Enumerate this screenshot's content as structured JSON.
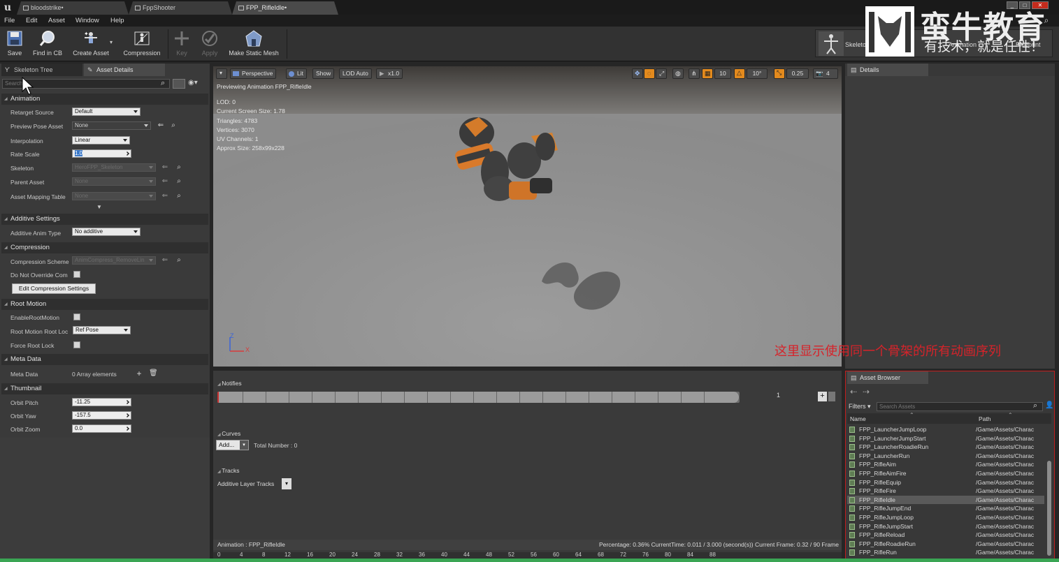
{
  "titlebar": {
    "tabs": [
      {
        "label": "bloodstrike•"
      },
      {
        "label": "FppShooter"
      },
      {
        "label": "FPP_RifleIdle•"
      }
    ],
    "window_buttons": [
      "_",
      "□",
      "✕"
    ]
  },
  "menubar": {
    "items": [
      "File",
      "Edit",
      "Asset",
      "Window",
      "Help"
    ]
  },
  "toolbar": {
    "save": "Save",
    "find_in_cb": "Find in CB",
    "create_asset": "Create Asset",
    "compression": "Compression",
    "key": "Key",
    "apply": "Apply",
    "make_static_mesh": "Make Static Mesh",
    "mode_skeleton": "Skeleton",
    "mode_animation": "Animation",
    "mode_blueprint": "Blueprint"
  },
  "left_panel": {
    "tabs": [
      "Skeleton Tree",
      "Asset Details"
    ],
    "search_placeholder": "Search",
    "animation": {
      "header": "Animation",
      "retarget_source_label": "Retarget Source",
      "retarget_source_value": "Default",
      "preview_pose_label": "Preview Pose Asset",
      "preview_pose_value": "None",
      "interpolation_label": "Interpolation",
      "interpolation_value": "Linear",
      "rate_scale_label": "Rate Scale",
      "rate_scale_value": "1.0",
      "skeleton_label": "Skeleton",
      "skeleton_value": "HeroFPP_Skeleton",
      "parent_asset_label": "Parent Asset",
      "parent_asset_value": "None",
      "asset_mapping_label": "Asset Mapping Table",
      "asset_mapping_value": "None"
    },
    "additive": {
      "header": "Additive Settings",
      "anim_type_label": "Additive Anim Type",
      "anim_type_value": "No additive"
    },
    "compression": {
      "header": "Compression",
      "scheme_label": "Compression Scheme",
      "scheme_value": "AnimCompress_RemoveLin",
      "override_label": "Do Not Override Com",
      "edit_button": "Edit Compression Settings"
    },
    "root_motion": {
      "header": "Root Motion",
      "enable_label": "EnableRootMotion",
      "lock_label": "Root Motion Root Loc",
      "lock_value": "Ref Pose",
      "force_label": "Force Root Lock"
    },
    "meta_data": {
      "header": "Meta Data",
      "label": "Meta Data",
      "value": "0 Array elements"
    },
    "thumbnail": {
      "header": "Thumbnail",
      "pitch_label": "Orbit Pitch",
      "pitch_value": "-11.25",
      "yaw_label": "Orbit Yaw",
      "yaw_value": "-157.5",
      "zoom_label": "Orbit Zoom",
      "zoom_value": "0.0"
    }
  },
  "viewport": {
    "perspective": "Perspective",
    "lit": "Lit",
    "show": "Show",
    "lod_auto": "LOD Auto",
    "speed": "x1.0",
    "grid_value": "10",
    "angle_value": "10°",
    "scale_value": "0.25",
    "camera_speed": "4",
    "previewing": "Previewing Animation FPP_RifleIdle",
    "info_lines": [
      "LOD: 0",
      "Current Screen Size: 1.78",
      "Triangles: 4783",
      "Vertices: 3070",
      "UV Channels: 1",
      "Approx Size: 258x99x228"
    ],
    "axis_z": "Z",
    "axis_x": "X"
  },
  "details": {
    "tab": "Details"
  },
  "timeline": {
    "notifies": "Notifies",
    "track_number": "1",
    "curves": "Curves",
    "add_button": "Add...",
    "total_number": "Total Number : 0",
    "tracks": "Tracks",
    "additive_layer": "Additive Layer Tracks",
    "status_animation": "Animation :  FPP_RifleIdle",
    "status_right": "Percentage: 0.36% CurrentTime: 0.011 / 3.000 (second(s)) Current Frame: 0.32 / 90 Frame",
    "ruler": [
      "0",
      "4",
      "8",
      "12",
      "16",
      "20",
      "24",
      "28",
      "32",
      "36",
      "40",
      "44",
      "48",
      "52",
      "56",
      "60",
      "64",
      "68",
      "72",
      "76",
      "80",
      "84",
      "88"
    ]
  },
  "asset_browser": {
    "tab": "Asset Browser",
    "filters": "Filters",
    "search_placeholder": "Search Assets",
    "col_name": "Name",
    "col_path": "Path",
    "rows": [
      {
        "name": "FPP_LauncherJumpLoop",
        "path": "/Game/Assets/Charac"
      },
      {
        "name": "FPP_LauncherJumpStart",
        "path": "/Game/Assets/Charac"
      },
      {
        "name": "FPP_LauncherRoadieRun",
        "path": "/Game/Assets/Charac"
      },
      {
        "name": "FPP_LauncherRun",
        "path": "/Game/Assets/Charac"
      },
      {
        "name": "FPP_RifleAim",
        "path": "/Game/Assets/Charac"
      },
      {
        "name": "FPP_RifleAimFire",
        "path": "/Game/Assets/Charac"
      },
      {
        "name": "FPP_RifleEquip",
        "path": "/Game/Assets/Charac"
      },
      {
        "name": "FPP_RifleFire",
        "path": "/Game/Assets/Charac"
      },
      {
        "name": "FPP_RifleIdle",
        "path": "/Game/Assets/Charac",
        "selected": true
      },
      {
        "name": "FPP_RifleJumpEnd",
        "path": "/Game/Assets/Charac"
      },
      {
        "name": "FPP_RifleJumpLoop",
        "path": "/Game/Assets/Charac"
      },
      {
        "name": "FPP_RifleJumpStart",
        "path": "/Game/Assets/Charac"
      },
      {
        "name": "FPP_RifleReload",
        "path": "/Game/Assets/Charac"
      },
      {
        "name": "FPP_RifleRoadieRun",
        "path": "/Game/Assets/Charac"
      },
      {
        "name": "FPP_RifleRun",
        "path": "/Game/Assets/Charac"
      }
    ]
  },
  "watermark": {
    "title": "蛮牛教育",
    "subtitle": "有技术，就是任性！"
  },
  "annotation": "这里显示使用同一个骨架的所有动画序列",
  "colors": {
    "accent_orange": "#e38a1d",
    "annotation_red": "#d6232a",
    "panel_bg": "#3a3a3a",
    "viewport_bg": "#8c8c8c"
  }
}
